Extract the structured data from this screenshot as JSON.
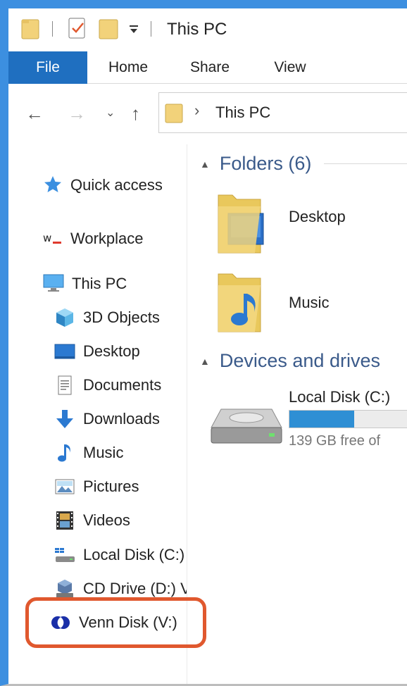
{
  "window": {
    "title": "This PC",
    "accent_color": "#3c8fe0"
  },
  "ribbon": {
    "tabs": [
      "File",
      "Home",
      "Share",
      "View"
    ]
  },
  "address": {
    "path": "This PC"
  },
  "nav_pane": {
    "quick_access": "Quick access",
    "workplace": "Workplace",
    "this_pc": "This PC",
    "items": [
      "3D Objects",
      "Desktop",
      "Documents",
      "Downloads",
      "Music",
      "Pictures",
      "Videos",
      "Local Disk (C:)",
      "CD Drive (D:) V"
    ],
    "venn_disk": "Venn Disk (V:)"
  },
  "content": {
    "folders_group": "Folders (6)",
    "folders": [
      "Desktop",
      "Music"
    ],
    "devices_group": "Devices and drives",
    "drives": [
      {
        "name": "Local Disk (C:)",
        "free_text": "139 GB free of",
        "used_fraction": 0.55
      }
    ]
  },
  "highlight_color": "#e0582e"
}
